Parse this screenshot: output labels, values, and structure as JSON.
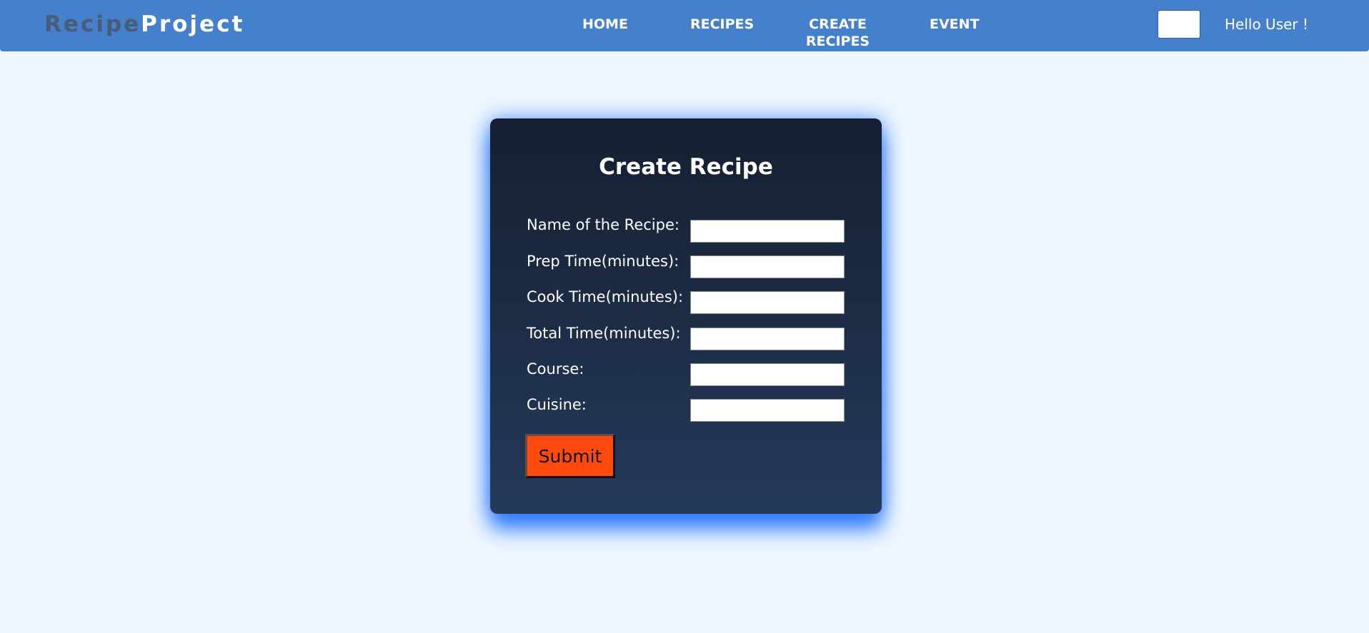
{
  "brand": {
    "part1": "Recipe",
    "part2": "Project"
  },
  "nav": {
    "home": "HOME",
    "recipes": "RECIPES",
    "create_line1": "CREATE",
    "create_line2": "RECIPES",
    "event": "EVENT"
  },
  "search": {
    "value": ""
  },
  "user": {
    "greeting": "Hello User !"
  },
  "form": {
    "title": "Create Recipe",
    "fields": [
      {
        "label": "Name of the Recipe:",
        "value": ""
      },
      {
        "label": "Prep Time(minutes):",
        "value": ""
      },
      {
        "label": "Cook Time(minutes):",
        "value": ""
      },
      {
        "label": "Total Time(minutes):",
        "value": ""
      },
      {
        "label": "Course:",
        "value": ""
      },
      {
        "label": "Cuisine:",
        "value": ""
      }
    ],
    "submit_label": "Submit"
  },
  "colors": {
    "navbar": "#4480cc",
    "page_background": "#eef6ff",
    "card_top": "#161f31",
    "card_bottom": "#243a5a",
    "submit_button": "#ff4a0f",
    "brand_dark": "#4a5b76",
    "glow": "#1e6eff"
  }
}
